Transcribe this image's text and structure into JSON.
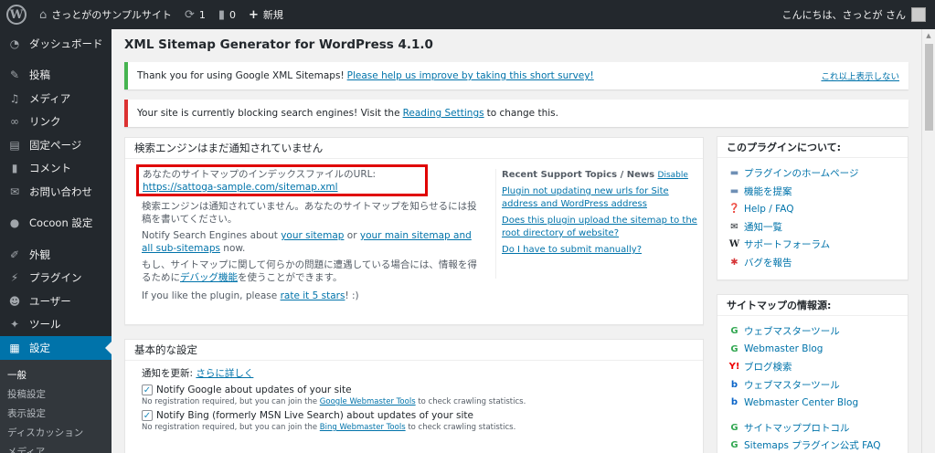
{
  "adminbar": {
    "site_name": "さっとがのサンプルサイト",
    "updates_count": "1",
    "comments_count": "0",
    "new_label": "新規",
    "greeting": "こんにちは、さっとが さん"
  },
  "sidebar": {
    "items": [
      {
        "label": "ダッシュボード",
        "icon": "dashboard-icon"
      },
      {
        "label": "投稿",
        "icon": "pin-icon"
      },
      {
        "label": "メディア",
        "icon": "media-icon"
      },
      {
        "label": "リンク",
        "icon": "link-icon"
      },
      {
        "label": "固定ページ",
        "icon": "page-icon"
      },
      {
        "label": "コメント",
        "icon": "comment-icon"
      },
      {
        "label": "お問い合わせ",
        "icon": "mail-icon"
      },
      {
        "label": "Cocoon 設定",
        "icon": "circle-icon"
      },
      {
        "label": "外観",
        "icon": "brush-icon"
      },
      {
        "label": "プラグイン",
        "icon": "plugin-icon"
      },
      {
        "label": "ユーザー",
        "icon": "user-icon"
      },
      {
        "label": "ツール",
        "icon": "wrench-icon"
      },
      {
        "label": "設定",
        "icon": "settings-icon"
      }
    ],
    "submenu": [
      "一般",
      "投稿設定",
      "表示設定",
      "ディスカッション",
      "メディア"
    ]
  },
  "page": {
    "title": "XML Sitemap Generator for WordPress 4.1.0"
  },
  "notices": {
    "survey_text": "Thank you for using Google XML Sitemaps! ",
    "survey_link": "Please help us improve by taking this short survey!",
    "dismiss": "これ以上表示しない",
    "blocking_text_before": "Your site is currently blocking search engines! Visit the ",
    "blocking_link": "Reading Settings",
    "blocking_text_after": " to change this."
  },
  "status": {
    "heading": "検索エンジンはまだ通知されていません",
    "sitemap_url_text": "あなたのサイトマップのインデックスファイルのURL: ",
    "sitemap_url": "https://sattoga-sample.com/sitemap.xml",
    "not_notified": "検索エンジンは通知されていません。あなたのサイトマップを知らせるには投稿を書いてください。",
    "notify_prefix": "Notify Search Engines about ",
    "notify_link1": "your sitemap",
    "notify_or": " or ",
    "notify_link2": "your main sitemap and all sub-sitemaps",
    "notify_suffix": " now.",
    "debug_before": "もし、サイトマップに関して何らかの問題に遭遇している場合には、情報を得るために",
    "debug_link": "デバッグ機能",
    "debug_after": "を使うことができます。",
    "rate_prefix": "If you like the plugin, please ",
    "rate_link": "rate it 5 stars",
    "rate_suffix": "! :)"
  },
  "support": {
    "heading": "Recent Support Topics / News",
    "disable": "Disable",
    "topics": [
      "Plugin not updating new urls for Site address and WordPress address",
      "Does this plugin upload the sitemap to the root directory of website?",
      "Do I have to submit manually?"
    ]
  },
  "settings": {
    "heading": "基本的な設定",
    "update_label": "通知を更新: ",
    "update_link": "さらに詳しく",
    "google_label": "Notify Google about updates of your site",
    "google_desc_before": "No registration required, but you can join the ",
    "google_desc_link": "Google Webmaster Tools",
    "google_desc_after": " to check crawling statistics.",
    "bing_label": "Notify Bing (formerly MSN Live Search) about updates of your site",
    "bing_desc_before": "No registration required, but you can join the ",
    "bing_desc_link": "Bing Webmaster Tools",
    "bing_desc_after": " to check crawling statistics."
  },
  "about": {
    "heading": "このプラグインについて:",
    "links": [
      {
        "label": "プラグインのホームページ",
        "icon": "image-icon"
      },
      {
        "label": "機能を提案",
        "icon": "image-icon"
      },
      {
        "label": "Help / FAQ",
        "icon": "help-icon"
      },
      {
        "label": "通知一覧",
        "icon": "mail-icon"
      },
      {
        "label": "サポートフォーラム",
        "icon": "wordpress-icon"
      },
      {
        "label": "バグを報告",
        "icon": "bug-icon"
      }
    ]
  },
  "resources": {
    "heading": "サイトマップの情報源:",
    "links": [
      {
        "label": "ウェブマスターツール",
        "icon": "google-icon"
      },
      {
        "label": "Webmaster Blog",
        "icon": "google-icon"
      },
      {
        "label": "ブログ検索",
        "icon": "yahoo-icon"
      },
      {
        "label": "ウェブマスターツール",
        "icon": "bing-icon"
      },
      {
        "label": "Webmaster Center Blog",
        "icon": "bing-icon"
      },
      {
        "label": "サイトマッププロトコル",
        "icon": "google-icon"
      },
      {
        "label": "Sitemaps プラグイン公式 FAQ",
        "icon": "google-icon"
      }
    ]
  },
  "colors": {
    "accent": "#0073aa",
    "admin_bg": "#23282d",
    "success": "#46b450",
    "error": "#dc3232",
    "highlight": "#e00000"
  }
}
